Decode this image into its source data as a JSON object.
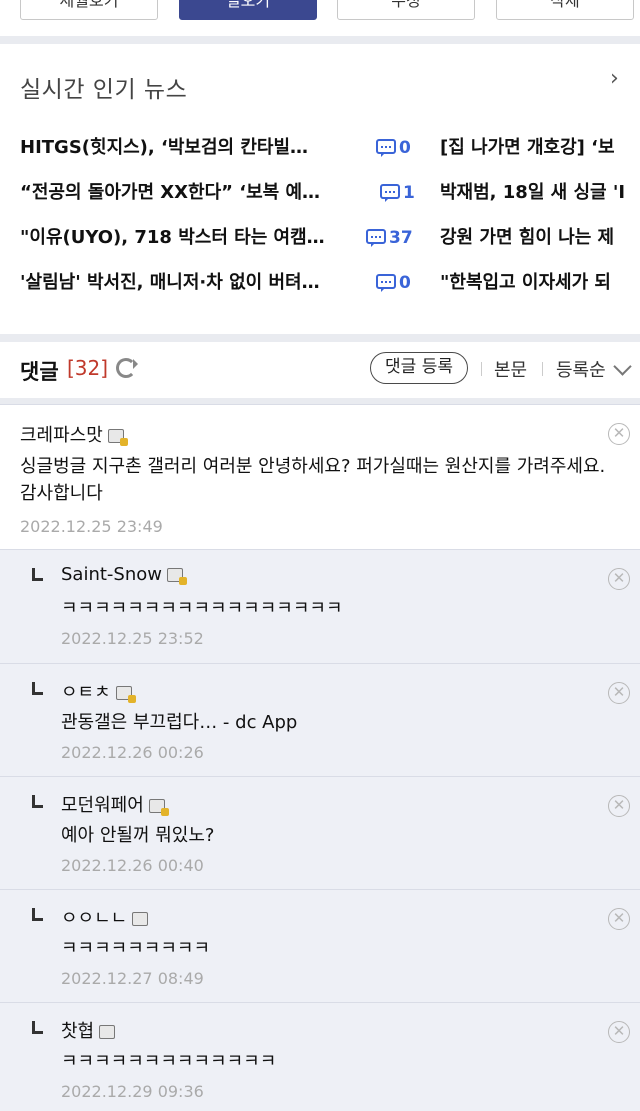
{
  "top_buttons": [
    {
      "label": "세월호기"
    },
    {
      "label": "일오기"
    },
    {
      "label": "수정"
    },
    {
      "label": "삭제"
    }
  ],
  "news": {
    "header": "실시간 인기 뉴스",
    "left": [
      {
        "title": "HITGS(힛지스), ‘박보검의 칸타빌…",
        "comments": "0"
      },
      {
        "title": "“전공의 돌아가면 XX한다” ‘보복 예…",
        "comments": "1"
      },
      {
        "title": "\"이유(UYO), 718 박스터 타는 여캠…",
        "comments": "37"
      },
      {
        "title": "'살림남' 박서진, 매니저·차 없이 버텨…",
        "comments": "0"
      }
    ],
    "right": [
      {
        "title": "[집 나가면 개호강] ‘보"
      },
      {
        "title": "박재범, 18일 새 싱글 'I"
      },
      {
        "title": "강원 가면 힘이 나는 제"
      },
      {
        "title": "\"한복입고 이자세가 되"
      }
    ]
  },
  "comments_header": {
    "title": "댓글",
    "count": "[32]",
    "register_label": "댓글 등록",
    "body_link": "본문",
    "sort_label": "등록순"
  },
  "comments": [
    {
      "author": "크레파스맛",
      "text": "싱글벙글 지구촌 갤러리 여러분 안녕하세요? 퍼가실때는 원산지를 가려주세요. 감사합니다",
      "date": "2022.12.25 23:49",
      "reply": false,
      "icon": "gold"
    },
    {
      "author": "Saint-Snow",
      "text": "ㅋㅋㅋㅋㅋㅋㅋㅋㅋㅋㅋㅋㅋㅋㅋㅋㅋ",
      "date": "2022.12.25 23:52",
      "reply": true,
      "icon": "gold"
    },
    {
      "author": "ㅇㅌㅊ",
      "text": "관동갤은 부끄럽다… - dc App",
      "date": "2022.12.26 00:26",
      "reply": true,
      "icon": "gold"
    },
    {
      "author": "모던워페어",
      "text": "예아 안될꺼 뭐있노?",
      "date": "2022.12.26 00:40",
      "reply": true,
      "icon": "gold"
    },
    {
      "author": "ㅇㅇㄴㄴ",
      "text": "ㅋㅋㅋㅋㅋㅋㅋㅋㅋ",
      "date": "2022.12.27 08:49",
      "reply": true,
      "icon": "plain"
    },
    {
      "author": "찻협",
      "text": "ㅋㅋㅋㅋㅋㅋㅋㅋㅋㅋㅋㅋㅋ",
      "date": "2022.12.29 09:36",
      "reply": true,
      "icon": "plain"
    }
  ],
  "icons": {
    "news_more": "chevron-right-icon",
    "comment_count": "speech-bubble-icon",
    "refresh": "refresh-icon",
    "sort": "chevron-down-icon",
    "delete": "close-circle-icon",
    "user": "gallery-user-icon",
    "reply": "reply-arrow-icon"
  },
  "colors": {
    "primary_button": "#3b4890",
    "comment_count_blue": "#3a64d8",
    "comment_total_red": "#c0392b",
    "reply_background": "#eef0f6"
  }
}
